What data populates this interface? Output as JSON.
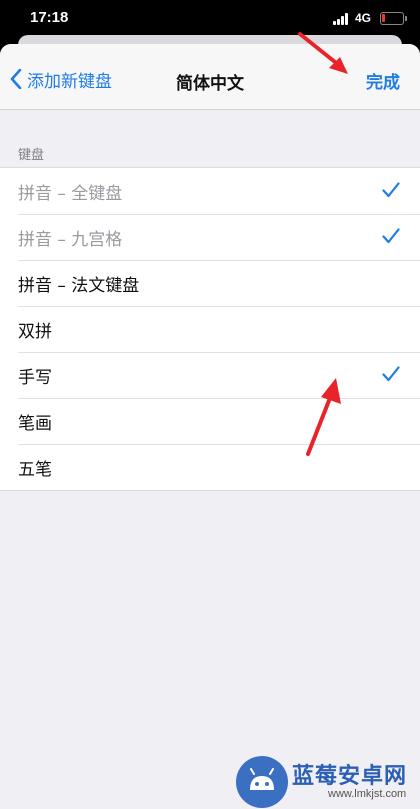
{
  "status_bar": {
    "time": "17:18",
    "network": "4G",
    "battery_color": "#e63a2e"
  },
  "nav": {
    "back_label": "添加新键盘",
    "title": "简体中文",
    "done_label": "完成",
    "accent_color": "#1f7ce6"
  },
  "section": {
    "header": "键盘"
  },
  "keyboards": [
    {
      "label": "拼音 – 全键盘",
      "checked": true,
      "dimmed": true
    },
    {
      "label": "拼音 – 九宫格",
      "checked": true,
      "dimmed": true
    },
    {
      "label": "拼音 – 法文键盘",
      "checked": false,
      "dimmed": false
    },
    {
      "label": "双拼",
      "checked": false,
      "dimmed": false
    },
    {
      "label": "手写",
      "checked": true,
      "dimmed": false
    },
    {
      "label": "笔画",
      "checked": false,
      "dimmed": false
    },
    {
      "label": "五笔",
      "checked": false,
      "dimmed": false
    }
  ],
  "watermark": {
    "name": "蓝莓安卓网",
    "url": "www.lmkjst.com"
  }
}
